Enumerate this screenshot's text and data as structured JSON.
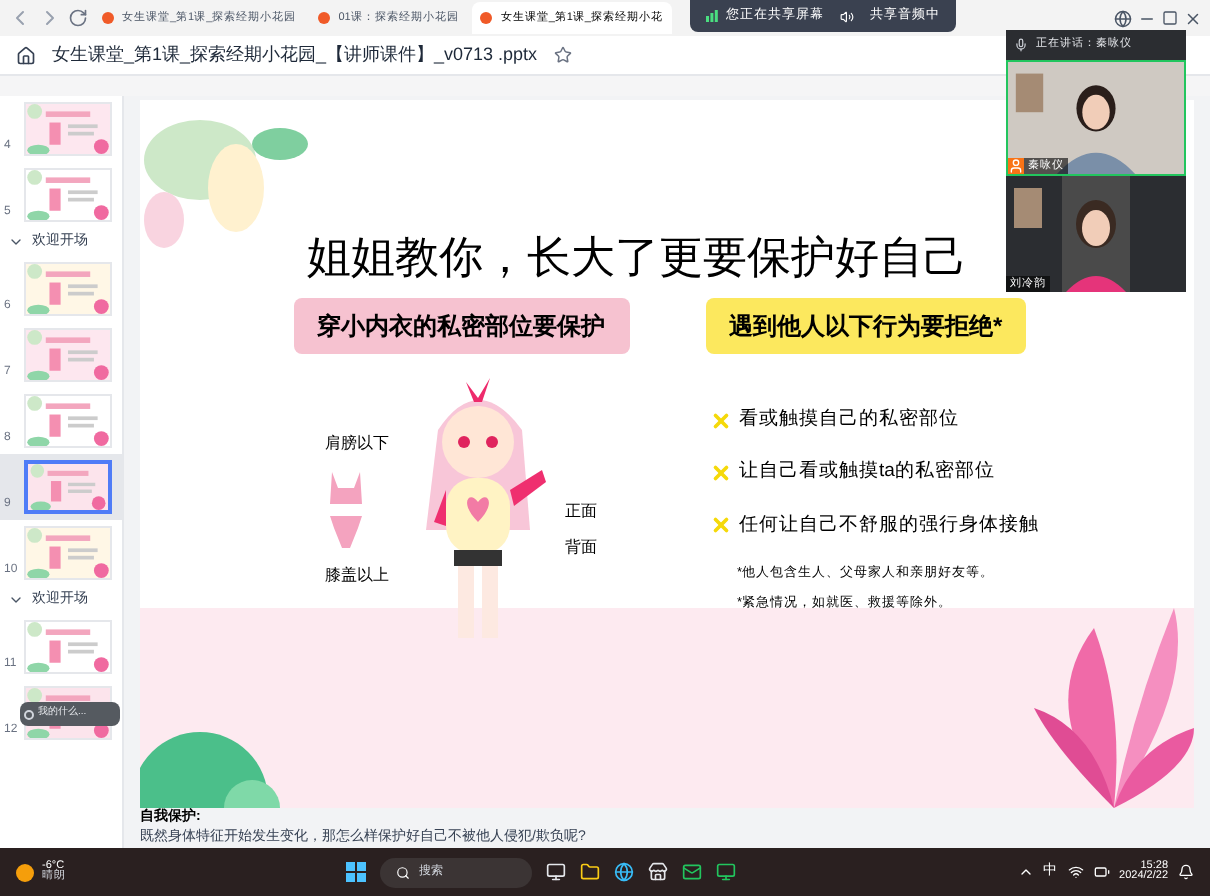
{
  "browser_tabs": [
    {
      "label": "女生课堂_第1课_探索经期小花园",
      "selected": false
    },
    {
      "label": "01课：探索经期小花园",
      "selected": false
    },
    {
      "label": "女生课堂_第1课_探索经期小花",
      "selected": true
    }
  ],
  "share_bar": {
    "status": "您正在共享屏幕",
    "audio": "共享音频中"
  },
  "document": {
    "title": "女生课堂_第1课_探索经期小花园_【讲师课件】_v0713 .pptx"
  },
  "thumbnails": [
    {
      "kind": "slide",
      "number": "4",
      "selected": false
    },
    {
      "kind": "slide",
      "number": "5",
      "selected": false
    },
    {
      "kind": "section",
      "label": "欢迎开场"
    },
    {
      "kind": "slide",
      "number": "6",
      "selected": false
    },
    {
      "kind": "slide",
      "number": "7",
      "selected": false
    },
    {
      "kind": "slide",
      "number": "8",
      "selected": false
    },
    {
      "kind": "slide",
      "number": "9",
      "selected": true
    },
    {
      "kind": "slide",
      "number": "10",
      "selected": false
    },
    {
      "kind": "section",
      "label": "欢迎开场"
    },
    {
      "kind": "slide",
      "number": "11",
      "selected": false
    },
    {
      "kind": "slide",
      "number": "12",
      "selected": false
    }
  ],
  "assistant_bar": {
    "placeholder": "我的什么..."
  },
  "slide": {
    "title": "姐姐教你，长大了更要保护好自己",
    "left_heading": "穿小内衣的私密部位要保护",
    "right_heading": "遇到他人以下行为要拒绝*",
    "body_labels": [
      "肩膀以下",
      "膝盖以上"
    ],
    "side_labels": [
      "正面",
      "背面"
    ],
    "rules": [
      "看或触摸自己的私密部位",
      "让自己看或触摸ta的私密部位",
      "任何让自己不舒服的强行身体接触"
    ],
    "footnotes": [
      "*他人包含生人、父母家人和亲朋好友等。",
      "*紧急情况，如就医、救援等除外。"
    ]
  },
  "notes": {
    "heading": "自我保护:",
    "text": "既然身体特征开始发生变化，那怎么样保护好自己不被他人侵犯/欺负呢?"
  },
  "video_call": {
    "speaking": "正在讲话：秦咏仪",
    "participants": [
      {
        "name": "秦咏仪",
        "host": true
      },
      {
        "name": "刘冷韵",
        "host": false
      }
    ]
  },
  "taskbar": {
    "weather_temp": "-6°C",
    "weather_text": "晴朗",
    "search": {
      "placeholder": "搜索"
    },
    "ime": "中",
    "time": "15:28",
    "date": "2024/2/22"
  }
}
